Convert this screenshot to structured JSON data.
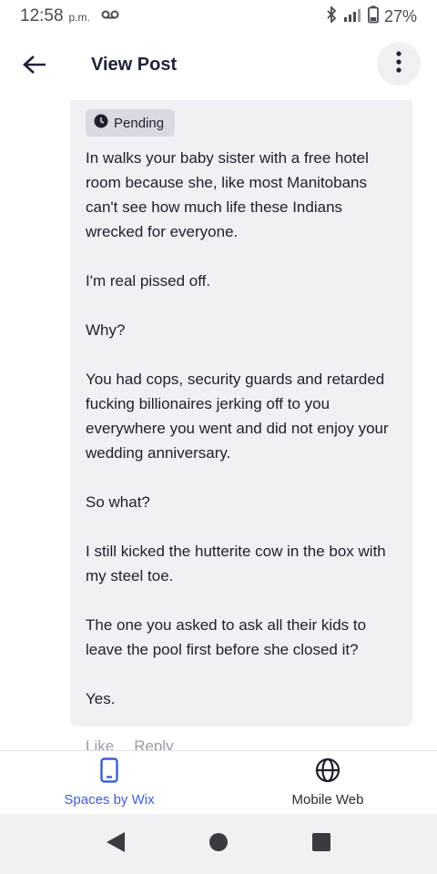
{
  "status_bar": {
    "time": "12:58",
    "ampm": "p.m.",
    "battery": "27%",
    "icons": [
      "voicemail-icon",
      "bluetooth-icon",
      "lte-signal-icon",
      "battery-icon"
    ]
  },
  "header": {
    "title": "View Post",
    "back_icon": "back-arrow-icon",
    "more_icon": "more-vertical-icon"
  },
  "post": {
    "status_badge": "Pending",
    "paragraphs": [
      "In walks your baby sister with a free hotel room because she, like most Manitobans can't see how much life these Indians wrecked for everyone.",
      "I'm real pissed off.",
      "Why?",
      "You had cops, security guards and retarded fucking billionaires jerking off to you everywhere you went and did not enjoy your wedding anniversary.",
      "So what?",
      "I still kicked the hutterite cow in the box with my steel toe.",
      "The one you asked to ask all their kids to leave the pool first before she closed it?",
      "Yes."
    ],
    "actions": {
      "like": "Like",
      "reply": "Reply"
    }
  },
  "bottom_nav": {
    "items": [
      {
        "label": "Spaces by Wix",
        "icon": "phone-icon",
        "active": true
      },
      {
        "label": "Mobile Web",
        "icon": "globe-icon",
        "active": false
      }
    ]
  },
  "colors": {
    "accent": "#3a5fd1",
    "card_bg": "#eff1f5",
    "badge_bg": "#d8dae2"
  }
}
